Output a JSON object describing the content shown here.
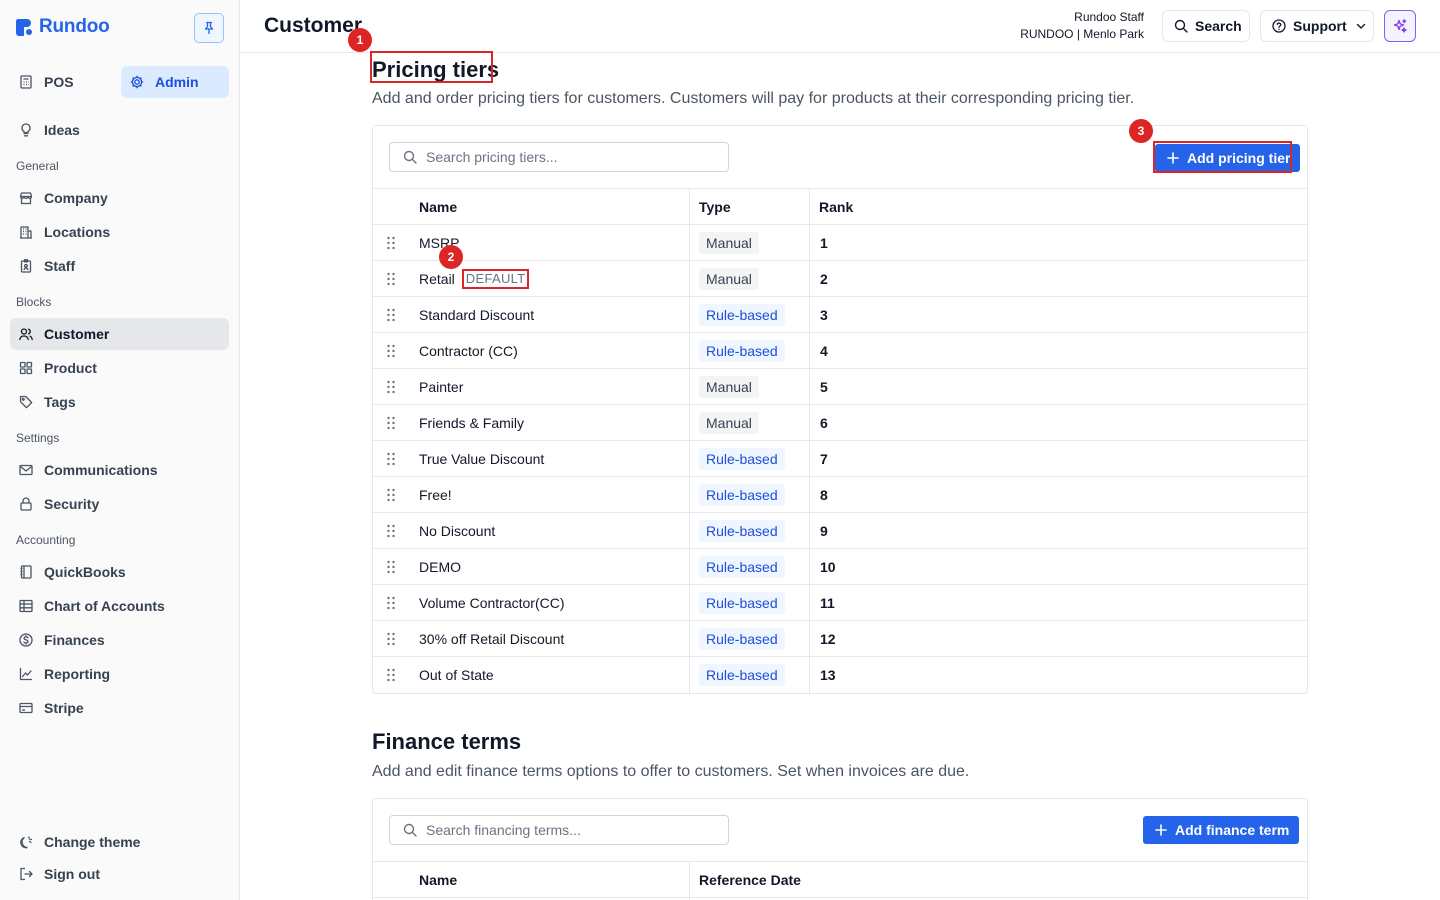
{
  "app": {
    "brand": "Rundoo",
    "colors": {
      "accent": "#2563eb",
      "annotation": "#dc2626",
      "ai": "#8b5cf6"
    }
  },
  "sidebar": {
    "mode_toggle": {
      "pos_label": "POS",
      "admin_label": "Admin",
      "active": "Admin"
    },
    "ideas_label": "Ideas",
    "sections": {
      "general": "General",
      "blocks": "Blocks",
      "settings": "Settings",
      "accounting": "Accounting"
    },
    "items": {
      "company": "Company",
      "locations": "Locations",
      "staff": "Staff",
      "customer": "Customer",
      "product": "Product",
      "tags": "Tags",
      "communications": "Communications",
      "security": "Security",
      "quickbooks": "QuickBooks",
      "chart_of_accounts": "Chart of Accounts",
      "finances": "Finances",
      "reporting": "Reporting",
      "stripe": "Stripe"
    },
    "active_item": "Customer",
    "footer": {
      "change_theme": "Change theme",
      "sign_out": "Sign out"
    }
  },
  "header": {
    "title": "Customer",
    "user_name": "Rundoo Staff",
    "user_location": "RUNDOO | Menlo Park",
    "search_label": "Search",
    "support_label": "Support"
  },
  "pricing": {
    "title": "Pricing tiers",
    "description": "Add and order pricing tiers for customers. Customers will pay for products at their corresponding pricing tier.",
    "search_placeholder": "Search pricing tiers...",
    "add_label": "Add pricing tier",
    "columns": {
      "name": "Name",
      "type": "Type",
      "rank": "Rank"
    },
    "default_badge": "DEFAULT",
    "rows": [
      {
        "name": "MSRP",
        "type": "Manual",
        "rank": "1"
      },
      {
        "name": "Retail",
        "type": "Manual",
        "rank": "2",
        "is_default": true
      },
      {
        "name": "Standard Discount",
        "type": "Rule-based",
        "rank": "3"
      },
      {
        "name": "Contractor (CC)",
        "type": "Rule-based",
        "rank": "4"
      },
      {
        "name": "Painter",
        "type": "Manual",
        "rank": "5"
      },
      {
        "name": "Friends & Family",
        "type": "Manual",
        "rank": "6"
      },
      {
        "name": "True Value Discount",
        "type": "Rule-based",
        "rank": "7"
      },
      {
        "name": "Free!",
        "type": "Rule-based",
        "rank": "8"
      },
      {
        "name": "No Discount",
        "type": "Rule-based",
        "rank": "9"
      },
      {
        "name": "DEMO",
        "type": "Rule-based",
        "rank": "10"
      },
      {
        "name": "Volume Contractor(CC)",
        "type": "Rule-based",
        "rank": "11"
      },
      {
        "name": "30% off Retail Discount",
        "type": "Rule-based",
        "rank": "12"
      },
      {
        "name": "Out of State",
        "type": "Rule-based",
        "rank": "13"
      }
    ]
  },
  "finance": {
    "title": "Finance terms",
    "description": "Add and edit finance terms options to offer to customers. Set when invoices are due.",
    "search_placeholder": "Search financing terms...",
    "add_label": "Add finance term",
    "columns": {
      "name": "Name",
      "reference_date": "Reference Date"
    }
  },
  "annotations": [
    "1",
    "2",
    "3"
  ]
}
